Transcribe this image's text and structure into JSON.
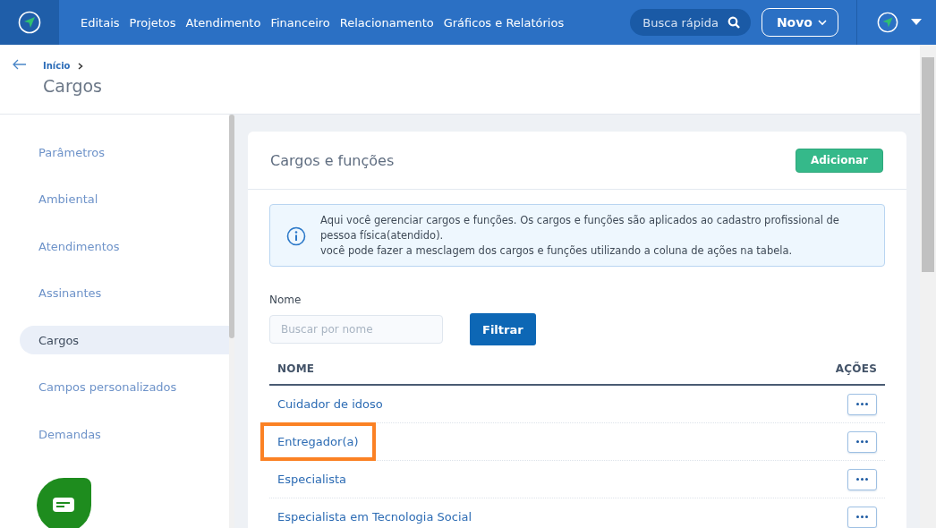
{
  "topbar": {
    "nav": [
      "Editais",
      "Projetos",
      "Atendimento",
      "Financeiro",
      "Relacionamento",
      "Gráficos e Relatórios"
    ],
    "search": {
      "placeholder": "Busca rápida"
    },
    "new_button": "Novo"
  },
  "breadcrumb": {
    "items": [
      "Início"
    ],
    "title": "Cargos"
  },
  "sidebar": {
    "items": [
      {
        "label": "Parâmetros",
        "selected": false
      },
      {
        "label": "Ambiental",
        "selected": false
      },
      {
        "label": "Atendimentos",
        "selected": false
      },
      {
        "label": "Assinantes",
        "selected": false
      },
      {
        "label": "Cargos",
        "selected": true
      },
      {
        "label": "Campos personalizados",
        "selected": false
      },
      {
        "label": "Demandas",
        "selected": false
      }
    ]
  },
  "card": {
    "title": "Cargos e funções",
    "add_button": "Adicionar",
    "info": [
      "Aqui você gerenciar cargos e funções. Os cargos e funções são aplicados ao cadastro profissional de pessoa física(atendido).",
      "você pode fazer a mesclagem dos cargos e funções utilizando a coluna de ações na tabela."
    ],
    "filter": {
      "label": "Nome",
      "placeholder": "Buscar por nome",
      "button": "Filtrar"
    },
    "table": {
      "columns": [
        "NOME",
        "AÇÕES"
      ],
      "rows": [
        {
          "name": "Cuidador de idoso",
          "highlighted": false
        },
        {
          "name": "Entregador(a)",
          "highlighted": true
        },
        {
          "name": "Especialista",
          "highlighted": false
        },
        {
          "name": "Especialista em Tecnologia Social",
          "highlighted": false
        }
      ]
    }
  }
}
